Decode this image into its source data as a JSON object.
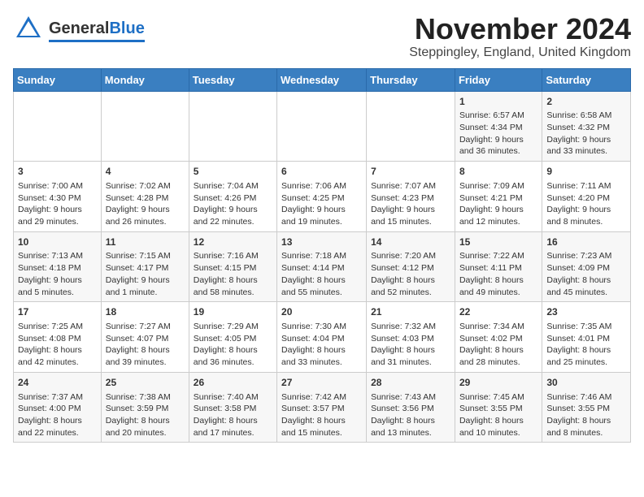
{
  "header": {
    "logo_general": "General",
    "logo_blue": "Blue",
    "month_title": "November 2024",
    "location": "Steppingley, England, United Kingdom"
  },
  "weekdays": [
    "Sunday",
    "Monday",
    "Tuesday",
    "Wednesday",
    "Thursday",
    "Friday",
    "Saturday"
  ],
  "weeks": [
    [
      {
        "day": "",
        "info": ""
      },
      {
        "day": "",
        "info": ""
      },
      {
        "day": "",
        "info": ""
      },
      {
        "day": "",
        "info": ""
      },
      {
        "day": "",
        "info": ""
      },
      {
        "day": "1",
        "info": "Sunrise: 6:57 AM\nSunset: 4:34 PM\nDaylight: 9 hours and 36 minutes."
      },
      {
        "day": "2",
        "info": "Sunrise: 6:58 AM\nSunset: 4:32 PM\nDaylight: 9 hours and 33 minutes."
      }
    ],
    [
      {
        "day": "3",
        "info": "Sunrise: 7:00 AM\nSunset: 4:30 PM\nDaylight: 9 hours and 29 minutes."
      },
      {
        "day": "4",
        "info": "Sunrise: 7:02 AM\nSunset: 4:28 PM\nDaylight: 9 hours and 26 minutes."
      },
      {
        "day": "5",
        "info": "Sunrise: 7:04 AM\nSunset: 4:26 PM\nDaylight: 9 hours and 22 minutes."
      },
      {
        "day": "6",
        "info": "Sunrise: 7:06 AM\nSunset: 4:25 PM\nDaylight: 9 hours and 19 minutes."
      },
      {
        "day": "7",
        "info": "Sunrise: 7:07 AM\nSunset: 4:23 PM\nDaylight: 9 hours and 15 minutes."
      },
      {
        "day": "8",
        "info": "Sunrise: 7:09 AM\nSunset: 4:21 PM\nDaylight: 9 hours and 12 minutes."
      },
      {
        "day": "9",
        "info": "Sunrise: 7:11 AM\nSunset: 4:20 PM\nDaylight: 9 hours and 8 minutes."
      }
    ],
    [
      {
        "day": "10",
        "info": "Sunrise: 7:13 AM\nSunset: 4:18 PM\nDaylight: 9 hours and 5 minutes."
      },
      {
        "day": "11",
        "info": "Sunrise: 7:15 AM\nSunset: 4:17 PM\nDaylight: 9 hours and 1 minute."
      },
      {
        "day": "12",
        "info": "Sunrise: 7:16 AM\nSunset: 4:15 PM\nDaylight: 8 hours and 58 minutes."
      },
      {
        "day": "13",
        "info": "Sunrise: 7:18 AM\nSunset: 4:14 PM\nDaylight: 8 hours and 55 minutes."
      },
      {
        "day": "14",
        "info": "Sunrise: 7:20 AM\nSunset: 4:12 PM\nDaylight: 8 hours and 52 minutes."
      },
      {
        "day": "15",
        "info": "Sunrise: 7:22 AM\nSunset: 4:11 PM\nDaylight: 8 hours and 49 minutes."
      },
      {
        "day": "16",
        "info": "Sunrise: 7:23 AM\nSunset: 4:09 PM\nDaylight: 8 hours and 45 minutes."
      }
    ],
    [
      {
        "day": "17",
        "info": "Sunrise: 7:25 AM\nSunset: 4:08 PM\nDaylight: 8 hours and 42 minutes."
      },
      {
        "day": "18",
        "info": "Sunrise: 7:27 AM\nSunset: 4:07 PM\nDaylight: 8 hours and 39 minutes."
      },
      {
        "day": "19",
        "info": "Sunrise: 7:29 AM\nSunset: 4:05 PM\nDaylight: 8 hours and 36 minutes."
      },
      {
        "day": "20",
        "info": "Sunrise: 7:30 AM\nSunset: 4:04 PM\nDaylight: 8 hours and 33 minutes."
      },
      {
        "day": "21",
        "info": "Sunrise: 7:32 AM\nSunset: 4:03 PM\nDaylight: 8 hours and 31 minutes."
      },
      {
        "day": "22",
        "info": "Sunrise: 7:34 AM\nSunset: 4:02 PM\nDaylight: 8 hours and 28 minutes."
      },
      {
        "day": "23",
        "info": "Sunrise: 7:35 AM\nSunset: 4:01 PM\nDaylight: 8 hours and 25 minutes."
      }
    ],
    [
      {
        "day": "24",
        "info": "Sunrise: 7:37 AM\nSunset: 4:00 PM\nDaylight: 8 hours and 22 minutes."
      },
      {
        "day": "25",
        "info": "Sunrise: 7:38 AM\nSunset: 3:59 PM\nDaylight: 8 hours and 20 minutes."
      },
      {
        "day": "26",
        "info": "Sunrise: 7:40 AM\nSunset: 3:58 PM\nDaylight: 8 hours and 17 minutes."
      },
      {
        "day": "27",
        "info": "Sunrise: 7:42 AM\nSunset: 3:57 PM\nDaylight: 8 hours and 15 minutes."
      },
      {
        "day": "28",
        "info": "Sunrise: 7:43 AM\nSunset: 3:56 PM\nDaylight: 8 hours and 13 minutes."
      },
      {
        "day": "29",
        "info": "Sunrise: 7:45 AM\nSunset: 3:55 PM\nDaylight: 8 hours and 10 minutes."
      },
      {
        "day": "30",
        "info": "Sunrise: 7:46 AM\nSunset: 3:55 PM\nDaylight: 8 hours and 8 minutes."
      }
    ]
  ]
}
